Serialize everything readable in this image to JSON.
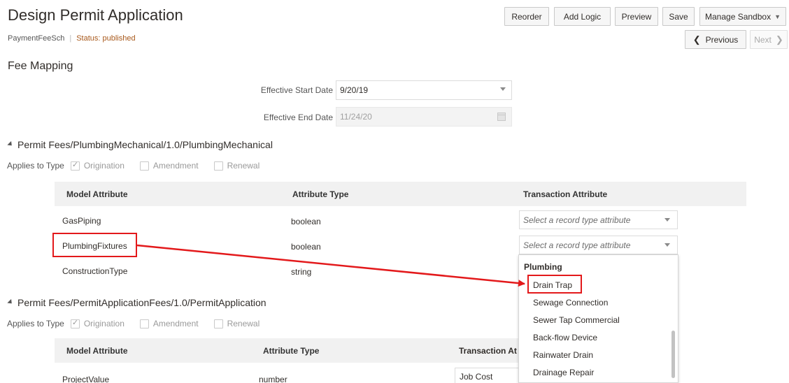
{
  "page": {
    "title": "Design Permit Application",
    "code": "PaymentFeeSch",
    "status": "Status: published"
  },
  "toolbar": {
    "reorder": "Reorder",
    "add_logic": "Add Logic",
    "preview": "Preview",
    "save": "Save",
    "manage_sandbox": "Manage Sandbox",
    "previous": "Previous",
    "next": "Next"
  },
  "fee_mapping": {
    "heading": "Fee Mapping",
    "start_label": "Effective Start Date",
    "start_value": "9/20/19",
    "end_label": "Effective End Date",
    "end_value": "11/24/20"
  },
  "groups": [
    {
      "title": "Permit Fees/PlumbingMechanical/1.0/PlumbingMechanical",
      "applies_label": "Applies to Type",
      "options": [
        "Origination",
        "Amendment",
        "Renewal"
      ],
      "headers": [
        "Model Attribute",
        "Attribute Type",
        "Transaction Attribute"
      ],
      "rows": [
        {
          "model": "GasPiping",
          "type": "boolean",
          "transaction": "Select a record type attribute"
        },
        {
          "model": "PlumbingFixtures",
          "type": "boolean",
          "transaction": "Select a record type attribute"
        },
        {
          "model": "ConstructionType",
          "type": "string",
          "transaction": ""
        }
      ]
    },
    {
      "title": "Permit Fees/PermitApplicationFees/1.0/PermitApplication",
      "applies_label": "Applies to Type",
      "options": [
        "Origination",
        "Amendment",
        "Renewal"
      ],
      "headers": [
        "Model Attribute",
        "Attribute Type",
        "Transaction At"
      ],
      "rows": [
        {
          "model": "ProjectValue",
          "type": "number",
          "transaction": "Job Cost"
        }
      ]
    }
  ],
  "dropdown": {
    "group": "Plumbing",
    "options": [
      "Drain Trap",
      "Sewage Connection",
      "Sewer Tap Commercial",
      "Back-flow Device",
      "Rainwater Drain",
      "Drainage Repair"
    ]
  },
  "colors": {
    "accent_status": "#a8581a",
    "highlight": "#e3191b",
    "header_bg": "#f1f1f1"
  }
}
